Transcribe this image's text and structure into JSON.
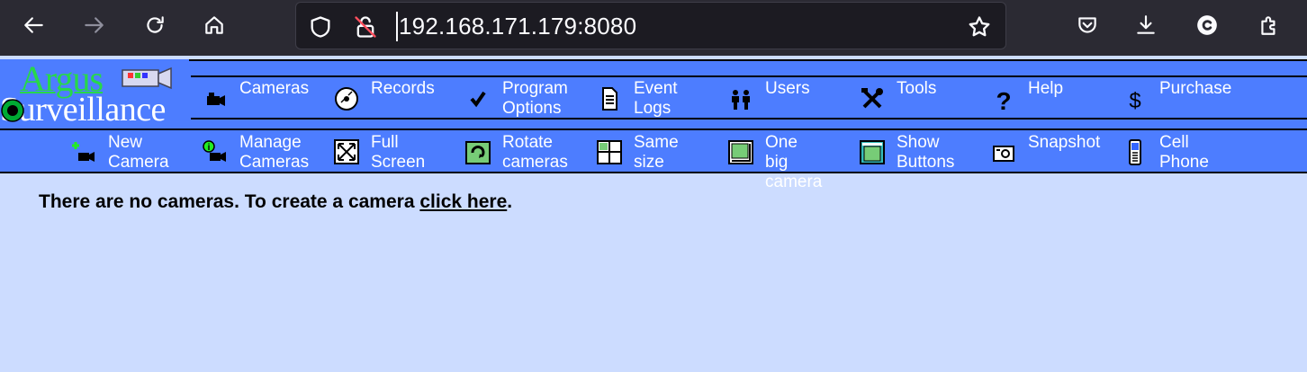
{
  "browser": {
    "url": "192.168.171.179:8080"
  },
  "app": {
    "logo_text_top": "Argus",
    "logo_text_bottom": "Surveillance"
  },
  "main_nav": [
    {
      "label": "Cameras",
      "icon": "camera-icon"
    },
    {
      "label": "Records",
      "icon": "disc-icon"
    },
    {
      "label": "Program\nOptions",
      "icon": "checkmark-icon"
    },
    {
      "label": "Event\nLogs",
      "icon": "document-icon"
    },
    {
      "label": "Users",
      "icon": "users-icon"
    },
    {
      "label": "Tools",
      "icon": "tools-icon"
    },
    {
      "label": "Help",
      "icon": "question-icon"
    },
    {
      "label": "Purchase",
      "icon": "dollar-icon"
    }
  ],
  "sub_nav": [
    {
      "label": "New\nCamera",
      "icon": "new-camera-icon"
    },
    {
      "label": "Manage\nCameras",
      "icon": "manage-cameras-icon"
    },
    {
      "label": "Full\nScreen",
      "icon": "fullscreen-icon"
    },
    {
      "label": "Rotate\ncameras",
      "icon": "rotate-icon"
    },
    {
      "label": "Same\nsize",
      "icon": "grid-icon"
    },
    {
      "label": "One big\ncamera",
      "icon": "big-camera-icon"
    },
    {
      "label": "Show\nButtons",
      "icon": "show-buttons-icon"
    },
    {
      "label": "Snapshot",
      "icon": "snapshot-icon"
    },
    {
      "label": "Cell\nPhone",
      "icon": "cell-phone-icon"
    }
  ],
  "message": {
    "text": "There are no cameras. To create a camera ",
    "link": "click here",
    "end": "."
  }
}
